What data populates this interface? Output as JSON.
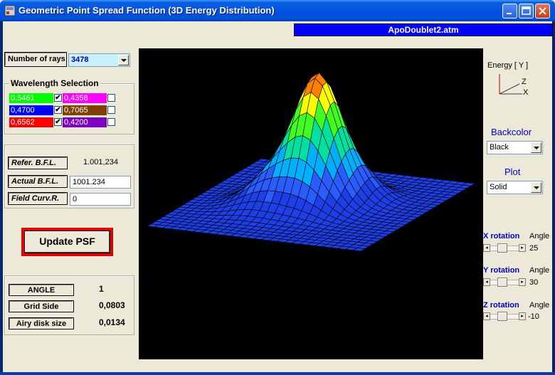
{
  "window": {
    "title": "Geometric Point Spread Function (3D Energy Distribution)",
    "file_banner": "ApoDoublet2.atm"
  },
  "rays": {
    "label": "Number of rays",
    "value": "3478"
  },
  "wavelengths": {
    "title": "Wavelength Selection",
    "items": [
      {
        "value": "0,5461",
        "color": "#00FF00",
        "checked": true
      },
      {
        "value": "0,4358",
        "color": "#FF00FF",
        "checked": false
      },
      {
        "value": "0,4700",
        "color": "#0000FF",
        "checked": true
      },
      {
        "value": "0,7065",
        "color": "#804000",
        "checked": false
      },
      {
        "value": "0,6562",
        "color": "#FF0000",
        "checked": true
      },
      {
        "value": "0,4200",
        "color": "#8000C0",
        "checked": false
      }
    ]
  },
  "bfl": {
    "refer_label": "Refer.  B.F.L.",
    "refer_value": "1.001,234",
    "actual_label": "Actual B.F.L.",
    "actual_value": "1001.234",
    "fieldcurv_label": "Field Curv.R.",
    "fieldcurv_value": "0"
  },
  "update_button": "Update PSF",
  "info": {
    "angle_label": "ANGLE",
    "angle_value": "1",
    "grid_label": "Grid  Side",
    "grid_value": "0,0803",
    "airy_label": "Airy disk size",
    "airy_value": "0,0134"
  },
  "axes_legend": {
    "energy": "Energy [ Y ]",
    "z": "Z",
    "x": "X"
  },
  "backcolor": {
    "label": "Backcolor",
    "value": "Black"
  },
  "plot_style": {
    "label": "Plot",
    "value": "Solid"
  },
  "rotation": {
    "angle_label": "Angle",
    "x": {
      "label": "X rotation",
      "value": "25"
    },
    "y": {
      "label": "Y rotation",
      "value": "30"
    },
    "z": {
      "label": "Z rotation",
      "value": "-10"
    }
  }
}
